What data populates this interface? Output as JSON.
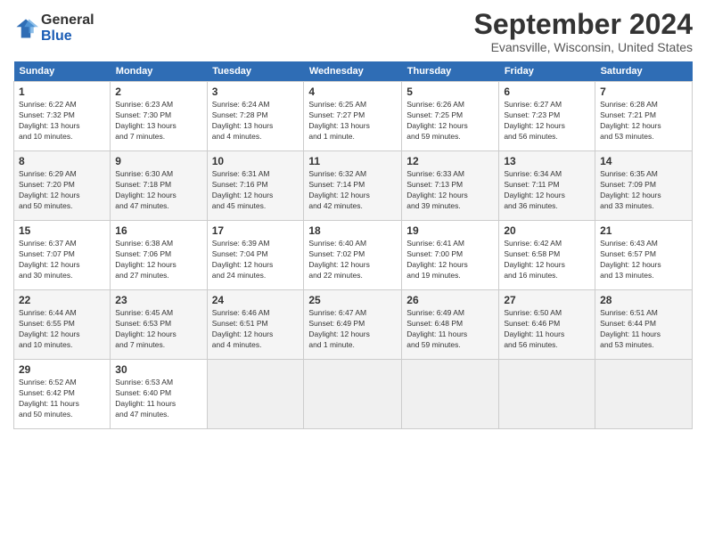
{
  "header": {
    "logo_general": "General",
    "logo_blue": "Blue",
    "title": "September 2024",
    "location": "Evansville, Wisconsin, United States"
  },
  "days_of_week": [
    "Sunday",
    "Monday",
    "Tuesday",
    "Wednesday",
    "Thursday",
    "Friday",
    "Saturday"
  ],
  "weeks": [
    [
      {
        "day": "1",
        "info": "Sunrise: 6:22 AM\nSunset: 7:32 PM\nDaylight: 13 hours\nand 10 minutes."
      },
      {
        "day": "2",
        "info": "Sunrise: 6:23 AM\nSunset: 7:30 PM\nDaylight: 13 hours\nand 7 minutes."
      },
      {
        "day": "3",
        "info": "Sunrise: 6:24 AM\nSunset: 7:28 PM\nDaylight: 13 hours\nand 4 minutes."
      },
      {
        "day": "4",
        "info": "Sunrise: 6:25 AM\nSunset: 7:27 PM\nDaylight: 13 hours\nand 1 minute."
      },
      {
        "day": "5",
        "info": "Sunrise: 6:26 AM\nSunset: 7:25 PM\nDaylight: 12 hours\nand 59 minutes."
      },
      {
        "day": "6",
        "info": "Sunrise: 6:27 AM\nSunset: 7:23 PM\nDaylight: 12 hours\nand 56 minutes."
      },
      {
        "day": "7",
        "info": "Sunrise: 6:28 AM\nSunset: 7:21 PM\nDaylight: 12 hours\nand 53 minutes."
      }
    ],
    [
      {
        "day": "8",
        "info": "Sunrise: 6:29 AM\nSunset: 7:20 PM\nDaylight: 12 hours\nand 50 minutes."
      },
      {
        "day": "9",
        "info": "Sunrise: 6:30 AM\nSunset: 7:18 PM\nDaylight: 12 hours\nand 47 minutes."
      },
      {
        "day": "10",
        "info": "Sunrise: 6:31 AM\nSunset: 7:16 PM\nDaylight: 12 hours\nand 45 minutes."
      },
      {
        "day": "11",
        "info": "Sunrise: 6:32 AM\nSunset: 7:14 PM\nDaylight: 12 hours\nand 42 minutes."
      },
      {
        "day": "12",
        "info": "Sunrise: 6:33 AM\nSunset: 7:13 PM\nDaylight: 12 hours\nand 39 minutes."
      },
      {
        "day": "13",
        "info": "Sunrise: 6:34 AM\nSunset: 7:11 PM\nDaylight: 12 hours\nand 36 minutes."
      },
      {
        "day": "14",
        "info": "Sunrise: 6:35 AM\nSunset: 7:09 PM\nDaylight: 12 hours\nand 33 minutes."
      }
    ],
    [
      {
        "day": "15",
        "info": "Sunrise: 6:37 AM\nSunset: 7:07 PM\nDaylight: 12 hours\nand 30 minutes."
      },
      {
        "day": "16",
        "info": "Sunrise: 6:38 AM\nSunset: 7:06 PM\nDaylight: 12 hours\nand 27 minutes."
      },
      {
        "day": "17",
        "info": "Sunrise: 6:39 AM\nSunset: 7:04 PM\nDaylight: 12 hours\nand 24 minutes."
      },
      {
        "day": "18",
        "info": "Sunrise: 6:40 AM\nSunset: 7:02 PM\nDaylight: 12 hours\nand 22 minutes."
      },
      {
        "day": "19",
        "info": "Sunrise: 6:41 AM\nSunset: 7:00 PM\nDaylight: 12 hours\nand 19 minutes."
      },
      {
        "day": "20",
        "info": "Sunrise: 6:42 AM\nSunset: 6:58 PM\nDaylight: 12 hours\nand 16 minutes."
      },
      {
        "day": "21",
        "info": "Sunrise: 6:43 AM\nSunset: 6:57 PM\nDaylight: 12 hours\nand 13 minutes."
      }
    ],
    [
      {
        "day": "22",
        "info": "Sunrise: 6:44 AM\nSunset: 6:55 PM\nDaylight: 12 hours\nand 10 minutes."
      },
      {
        "day": "23",
        "info": "Sunrise: 6:45 AM\nSunset: 6:53 PM\nDaylight: 12 hours\nand 7 minutes."
      },
      {
        "day": "24",
        "info": "Sunrise: 6:46 AM\nSunset: 6:51 PM\nDaylight: 12 hours\nand 4 minutes."
      },
      {
        "day": "25",
        "info": "Sunrise: 6:47 AM\nSunset: 6:49 PM\nDaylight: 12 hours\nand 1 minute."
      },
      {
        "day": "26",
        "info": "Sunrise: 6:49 AM\nSunset: 6:48 PM\nDaylight: 11 hours\nand 59 minutes."
      },
      {
        "day": "27",
        "info": "Sunrise: 6:50 AM\nSunset: 6:46 PM\nDaylight: 11 hours\nand 56 minutes."
      },
      {
        "day": "28",
        "info": "Sunrise: 6:51 AM\nSunset: 6:44 PM\nDaylight: 11 hours\nand 53 minutes."
      }
    ],
    [
      {
        "day": "29",
        "info": "Sunrise: 6:52 AM\nSunset: 6:42 PM\nDaylight: 11 hours\nand 50 minutes."
      },
      {
        "day": "30",
        "info": "Sunrise: 6:53 AM\nSunset: 6:40 PM\nDaylight: 11 hours\nand 47 minutes."
      },
      {
        "day": "",
        "info": ""
      },
      {
        "day": "",
        "info": ""
      },
      {
        "day": "",
        "info": ""
      },
      {
        "day": "",
        "info": ""
      },
      {
        "day": "",
        "info": ""
      }
    ]
  ]
}
